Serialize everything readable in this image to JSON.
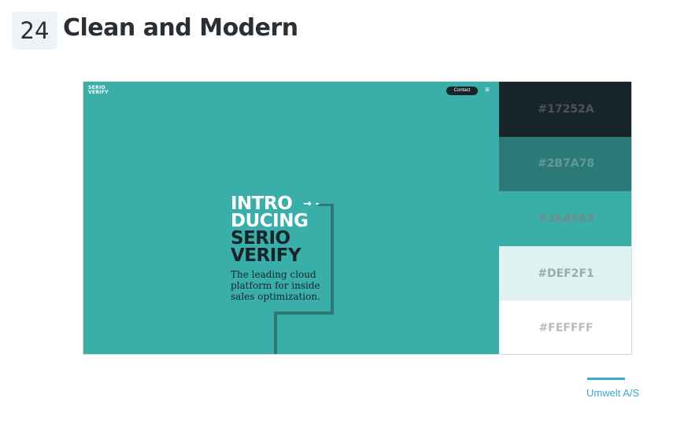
{
  "item_number": "24",
  "title": "Clean and Modern",
  "mockup": {
    "logo_line1": "SERIO",
    "logo_line2": "VERIFY",
    "contact_label": "Contact",
    "menu_icon": "hamburger-icon",
    "hero_lines": [
      "INTRO",
      "DUCING",
      "SERIO",
      "VERIFY"
    ],
    "arrow_text": "→ -",
    "subtitle": "The leading cloud platform for inside sales optimization."
  },
  "palette": [
    {
      "hex": "#17252A",
      "bg": "#17252a",
      "fg": "#4a5358"
    },
    {
      "hex": "#2B7A78",
      "bg": "#2b7a78",
      "fg": "#5f9b99"
    },
    {
      "hex": "#3AAFA9",
      "bg": "#3aafa9",
      "fg": "#6a8f8d"
    },
    {
      "hex": "#DEF2F1",
      "bg": "#def2f1",
      "fg": "#9aacab"
    },
    {
      "hex": "#FEFFFF",
      "bg": "#feffff",
      "fg": "#b8bcbd"
    }
  ],
  "credit": "Umwelt A/S"
}
